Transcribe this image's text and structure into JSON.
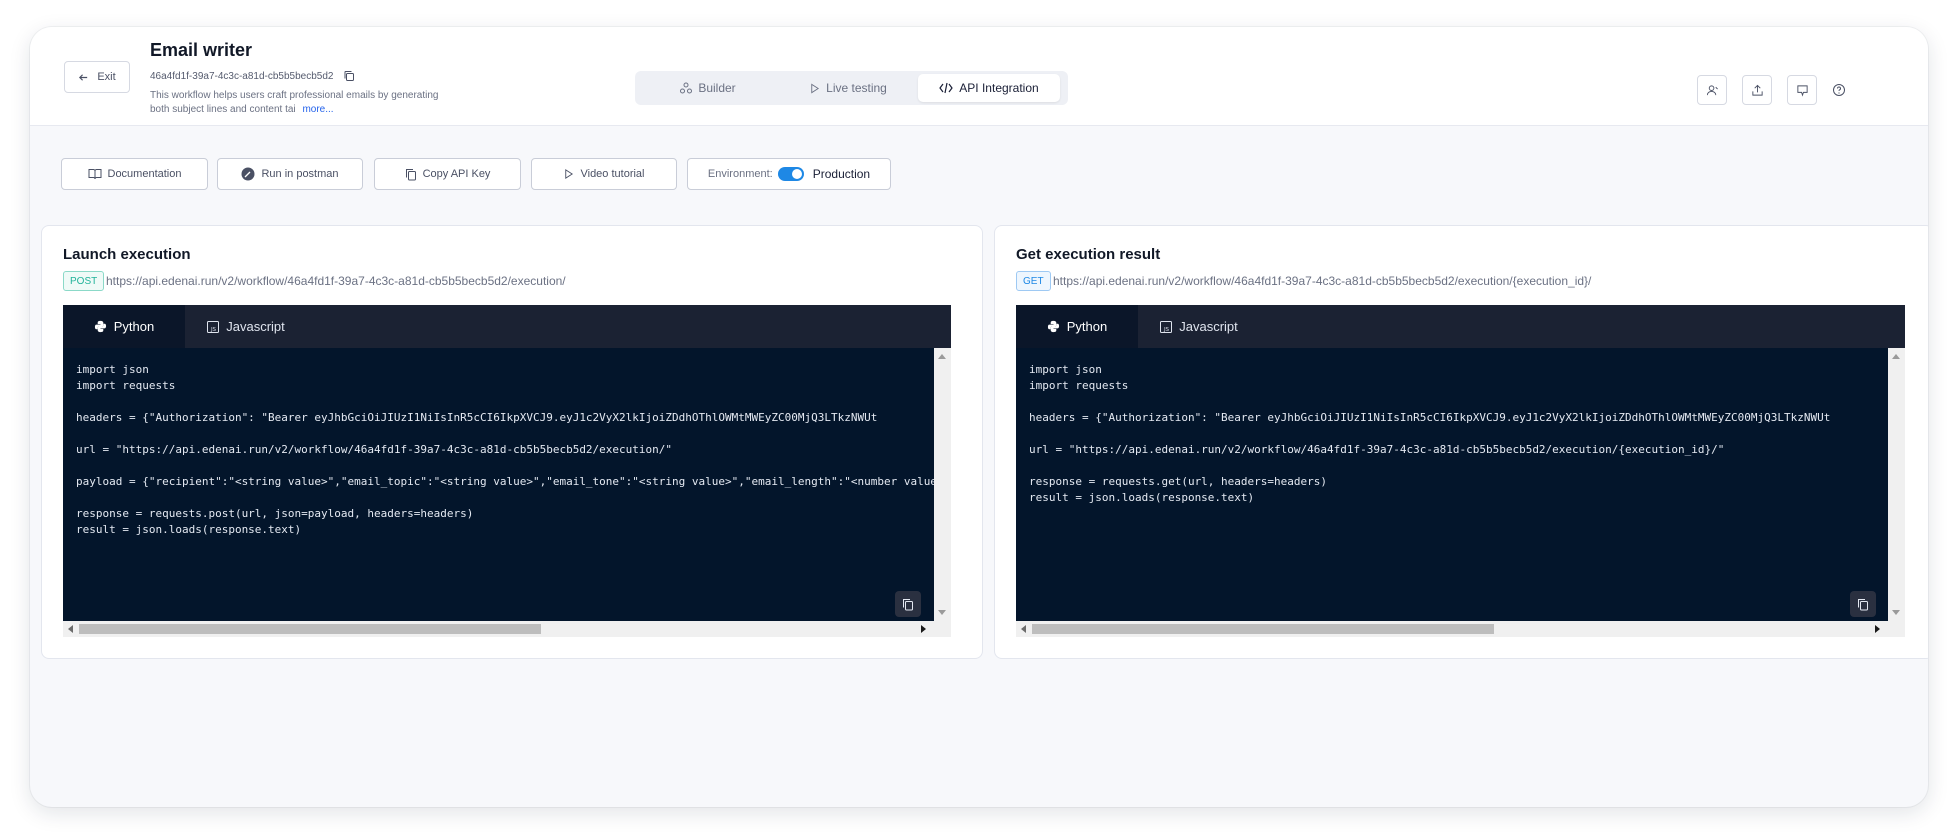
{
  "header": {
    "exit_label": "Exit",
    "title": "Email writer",
    "workflow_id": "46a4fd1f-39a7-4c3c-a81d-cb5b5becb5d2",
    "description": "This workflow helps users craft professional emails by generating both subject lines and content tai",
    "more_label": "more...",
    "modes": [
      {
        "label": "Builder",
        "icon": "builder-icon"
      },
      {
        "label": "Live testing",
        "icon": "play-icon"
      },
      {
        "label": "API Integration",
        "icon": "code-icon",
        "active": true
      }
    ],
    "actions": [
      "users-icon",
      "share-icon",
      "feedback-icon",
      "help-icon"
    ]
  },
  "toolbar": {
    "documentation": "Documentation",
    "postman": "Run in postman",
    "copy_key": "Copy API Key",
    "video": "Video tutorial",
    "environment_label": "Environment:",
    "environment_value": "Production"
  },
  "launch": {
    "title": "Launch execution",
    "method": "POST",
    "url": "https://api.edenai.run/v2/workflow/46a4fd1f-39a7-4c3c-a81d-cb5b5becb5d2/execution/",
    "tabs": [
      "Python",
      "Javascript"
    ],
    "code": "import json\nimport requests\n\nheaders = {\"Authorization\": \"Bearer eyJhbGciOiJIUzI1NiIsInR5cCI6IkpXVCJ9.eyJ1c2VyX2lkIjoiZDdhOThlOWMtMWEyZC00MjQ3LTkzNWUt\n\nurl = \"https://api.edenai.run/v2/workflow/46a4fd1f-39a7-4c3c-a81d-cb5b5becb5d2/execution/\"\n\npayload = {\"recipient\":\"<string value>\",\"email_topic\":\"<string value>\",\"email_tone\":\"<string value>\",\"email_length\":\"<number value>\"\n\nresponse = requests.post(url, json=payload, headers=headers)\nresult = json.loads(response.text)"
  },
  "result": {
    "title": "Get execution result",
    "method": "GET",
    "url": "https://api.edenai.run/v2/workflow/46a4fd1f-39a7-4c3c-a81d-cb5b5becb5d2/execution/{execution_id}/",
    "tabs": [
      "Python",
      "Javascript"
    ],
    "code": "import json\nimport requests\n\nheaders = {\"Authorization\": \"Bearer eyJhbGciOiJIUzI1NiIsInR5cCI6IkpXVCJ9.eyJ1c2VyX2lkIjoiZDdhOThlOWMtMWEyZC00MjQ3LTkzNWUt\n\nurl = \"https://api.edenai.run/v2/workflow/46a4fd1f-39a7-4c3c-a81d-cb5b5becb5d2/execution/{execution_id}/\"\n\nresponse = requests.get(url, headers=headers)\nresult = json.loads(response.text)"
  },
  "colors": {
    "post_green": "#22b39a",
    "get_blue": "#1e88e5",
    "code_bg": "#03152b",
    "toggle_on": "#1e88e5"
  }
}
